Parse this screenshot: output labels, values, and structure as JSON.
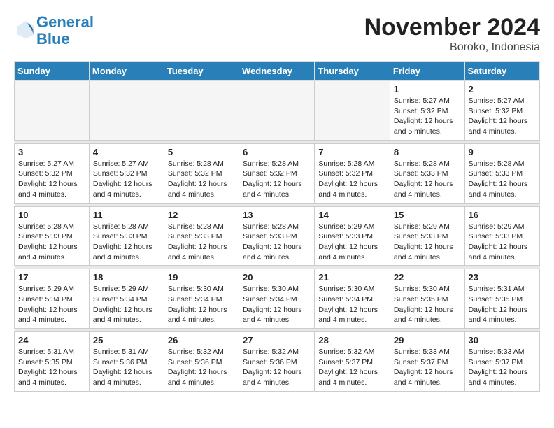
{
  "logo": {
    "line1": "General",
    "line2": "Blue"
  },
  "title": "November 2024",
  "location": "Boroko, Indonesia",
  "weekdays": [
    "Sunday",
    "Monday",
    "Tuesday",
    "Wednesday",
    "Thursday",
    "Friday",
    "Saturday"
  ],
  "weeks": [
    [
      {
        "day": "",
        "info": ""
      },
      {
        "day": "",
        "info": ""
      },
      {
        "day": "",
        "info": ""
      },
      {
        "day": "",
        "info": ""
      },
      {
        "day": "",
        "info": ""
      },
      {
        "day": "1",
        "info": "Sunrise: 5:27 AM\nSunset: 5:32 PM\nDaylight: 12 hours and 5 minutes."
      },
      {
        "day": "2",
        "info": "Sunrise: 5:27 AM\nSunset: 5:32 PM\nDaylight: 12 hours and 4 minutes."
      }
    ],
    [
      {
        "day": "3",
        "info": "Sunrise: 5:27 AM\nSunset: 5:32 PM\nDaylight: 12 hours and 4 minutes."
      },
      {
        "day": "4",
        "info": "Sunrise: 5:27 AM\nSunset: 5:32 PM\nDaylight: 12 hours and 4 minutes."
      },
      {
        "day": "5",
        "info": "Sunrise: 5:28 AM\nSunset: 5:32 PM\nDaylight: 12 hours and 4 minutes."
      },
      {
        "day": "6",
        "info": "Sunrise: 5:28 AM\nSunset: 5:32 PM\nDaylight: 12 hours and 4 minutes."
      },
      {
        "day": "7",
        "info": "Sunrise: 5:28 AM\nSunset: 5:32 PM\nDaylight: 12 hours and 4 minutes."
      },
      {
        "day": "8",
        "info": "Sunrise: 5:28 AM\nSunset: 5:33 PM\nDaylight: 12 hours and 4 minutes."
      },
      {
        "day": "9",
        "info": "Sunrise: 5:28 AM\nSunset: 5:33 PM\nDaylight: 12 hours and 4 minutes."
      }
    ],
    [
      {
        "day": "10",
        "info": "Sunrise: 5:28 AM\nSunset: 5:33 PM\nDaylight: 12 hours and 4 minutes."
      },
      {
        "day": "11",
        "info": "Sunrise: 5:28 AM\nSunset: 5:33 PM\nDaylight: 12 hours and 4 minutes."
      },
      {
        "day": "12",
        "info": "Sunrise: 5:28 AM\nSunset: 5:33 PM\nDaylight: 12 hours and 4 minutes."
      },
      {
        "day": "13",
        "info": "Sunrise: 5:28 AM\nSunset: 5:33 PM\nDaylight: 12 hours and 4 minutes."
      },
      {
        "day": "14",
        "info": "Sunrise: 5:29 AM\nSunset: 5:33 PM\nDaylight: 12 hours and 4 minutes."
      },
      {
        "day": "15",
        "info": "Sunrise: 5:29 AM\nSunset: 5:33 PM\nDaylight: 12 hours and 4 minutes."
      },
      {
        "day": "16",
        "info": "Sunrise: 5:29 AM\nSunset: 5:33 PM\nDaylight: 12 hours and 4 minutes."
      }
    ],
    [
      {
        "day": "17",
        "info": "Sunrise: 5:29 AM\nSunset: 5:34 PM\nDaylight: 12 hours and 4 minutes."
      },
      {
        "day": "18",
        "info": "Sunrise: 5:29 AM\nSunset: 5:34 PM\nDaylight: 12 hours and 4 minutes."
      },
      {
        "day": "19",
        "info": "Sunrise: 5:30 AM\nSunset: 5:34 PM\nDaylight: 12 hours and 4 minutes."
      },
      {
        "day": "20",
        "info": "Sunrise: 5:30 AM\nSunset: 5:34 PM\nDaylight: 12 hours and 4 minutes."
      },
      {
        "day": "21",
        "info": "Sunrise: 5:30 AM\nSunset: 5:34 PM\nDaylight: 12 hours and 4 minutes."
      },
      {
        "day": "22",
        "info": "Sunrise: 5:30 AM\nSunset: 5:35 PM\nDaylight: 12 hours and 4 minutes."
      },
      {
        "day": "23",
        "info": "Sunrise: 5:31 AM\nSunset: 5:35 PM\nDaylight: 12 hours and 4 minutes."
      }
    ],
    [
      {
        "day": "24",
        "info": "Sunrise: 5:31 AM\nSunset: 5:35 PM\nDaylight: 12 hours and 4 minutes."
      },
      {
        "day": "25",
        "info": "Sunrise: 5:31 AM\nSunset: 5:36 PM\nDaylight: 12 hours and 4 minutes."
      },
      {
        "day": "26",
        "info": "Sunrise: 5:32 AM\nSunset: 5:36 PM\nDaylight: 12 hours and 4 minutes."
      },
      {
        "day": "27",
        "info": "Sunrise: 5:32 AM\nSunset: 5:36 PM\nDaylight: 12 hours and 4 minutes."
      },
      {
        "day": "28",
        "info": "Sunrise: 5:32 AM\nSunset: 5:37 PM\nDaylight: 12 hours and 4 minutes."
      },
      {
        "day": "29",
        "info": "Sunrise: 5:33 AM\nSunset: 5:37 PM\nDaylight: 12 hours and 4 minutes."
      },
      {
        "day": "30",
        "info": "Sunrise: 5:33 AM\nSunset: 5:37 PM\nDaylight: 12 hours and 4 minutes."
      }
    ]
  ]
}
